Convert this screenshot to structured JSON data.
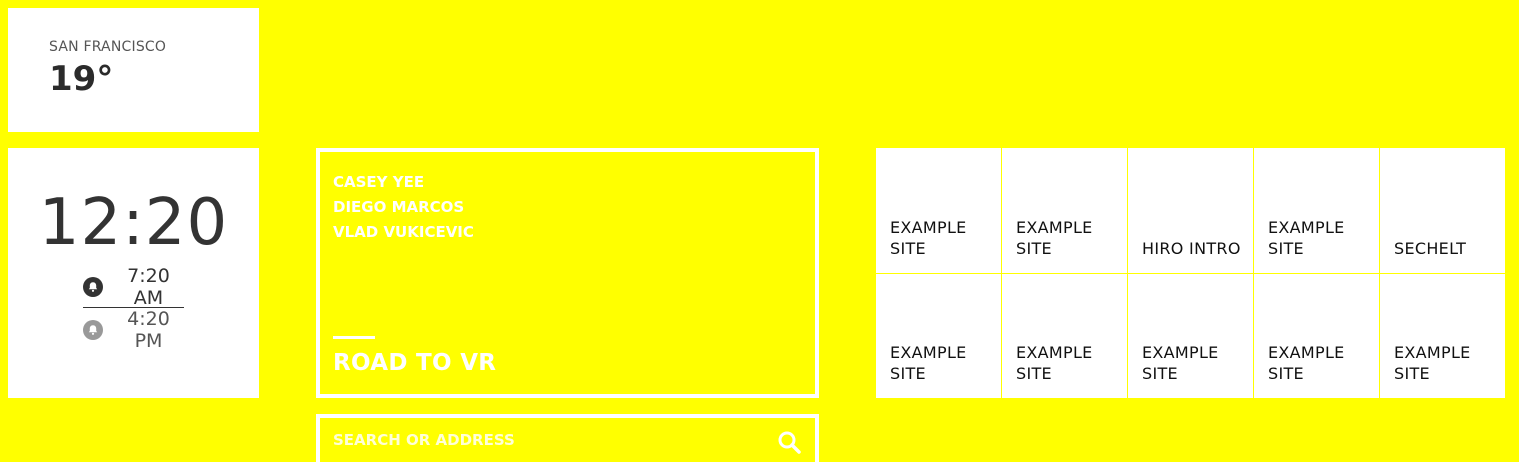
{
  "weather": {
    "city": "SAN FRANCISCO",
    "temperature": "19°"
  },
  "clock": {
    "time": "12:20",
    "alarms": [
      {
        "time": "7:20 AM",
        "enabled": true
      },
      {
        "time": "4:20 PM",
        "enabled": false
      }
    ]
  },
  "story": {
    "authors": [
      "CASEY YEE",
      "DIEGO MARCOS",
      "VLAD VUKICEVIC"
    ],
    "headline": "ROAD TO VR"
  },
  "search": {
    "placeholder": "SEARCH OR ADDRESS",
    "icon": "search-icon"
  },
  "tiles": [
    {
      "label": "EXAMPLE SITE"
    },
    {
      "label": "EXAMPLE SITE"
    },
    {
      "label": "HIRO INTRO"
    },
    {
      "label": "EXAMPLE SITE"
    },
    {
      "label": "SECHELT"
    },
    {
      "label": "EXAMPLE SITE"
    },
    {
      "label": "EXAMPLE SITE"
    },
    {
      "label": "EXAMPLE SITE"
    },
    {
      "label": "EXAMPLE SITE"
    },
    {
      "label": "EXAMPLE SITE"
    }
  ],
  "colors": {
    "background": "#ffff00",
    "card": "#ffffff",
    "text": "#333333"
  }
}
